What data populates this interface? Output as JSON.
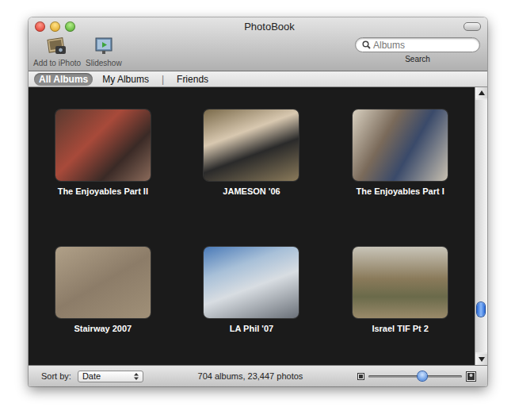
{
  "window": {
    "title": "PhotoBook"
  },
  "toolbar": [
    {
      "label": "Add to iPhoto",
      "kind": "iphoto"
    },
    {
      "label": "Slideshow",
      "kind": "slideshow"
    }
  ],
  "search": {
    "placeholder": "Albums",
    "label": "Search"
  },
  "tab_groups": [
    [
      {
        "label": "All Albums",
        "selected": true
      },
      {
        "label": "My Albums",
        "selected": false
      }
    ],
    [
      {
        "label": "Friends",
        "selected": false
      }
    ]
  ],
  "tab_separator": "|",
  "albums": [
    {
      "title": "The Enjoyables Part II"
    },
    {
      "title": "JAMESON '06"
    },
    {
      "title": "The Enjoyables Part I"
    },
    {
      "title": "Stairway 2007"
    },
    {
      "title": "LA Phil '07"
    },
    {
      "title": "Israel TIF Pt 2"
    }
  ],
  "scrollbar": {
    "level": 0.85
  },
  "status_bar": {
    "sort_label": "Sort by:",
    "sort_value": "Date",
    "summary": "704 albums, 23,447 photos",
    "zoom": {
      "level": 0.58
    }
  }
}
